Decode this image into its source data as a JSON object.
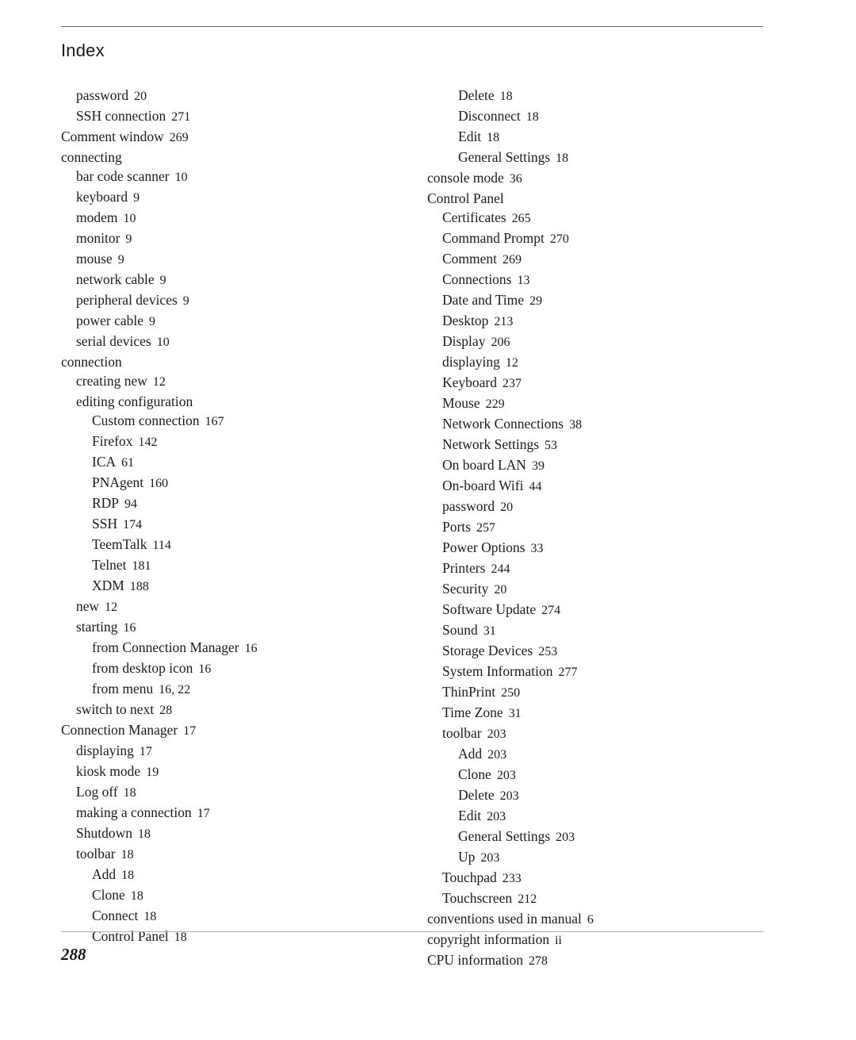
{
  "document": {
    "title": "Index",
    "folio": "288",
    "rule_color_top": "#6b6b6b",
    "rule_color_bottom": "#b3b3b3",
    "text_color": "#1b1b1b",
    "background": "#ffffff"
  },
  "columns": {
    "left": [
      {
        "level": 1,
        "term": "password",
        "pages": "20"
      },
      {
        "level": 1,
        "term": "SSH connection",
        "pages": "271"
      },
      {
        "level": 0,
        "term": "Comment window",
        "pages": "269"
      },
      {
        "level": 0,
        "term": "connecting",
        "pages": ""
      },
      {
        "level": 1,
        "term": "bar code scanner",
        "pages": "10"
      },
      {
        "level": 1,
        "term": "keyboard",
        "pages": "9"
      },
      {
        "level": 1,
        "term": "modem",
        "pages": "10"
      },
      {
        "level": 1,
        "term": "monitor",
        "pages": "9"
      },
      {
        "level": 1,
        "term": "mouse",
        "pages": "9"
      },
      {
        "level": 1,
        "term": "network cable",
        "pages": "9"
      },
      {
        "level": 1,
        "term": "peripheral devices",
        "pages": "9"
      },
      {
        "level": 1,
        "term": "power cable",
        "pages": "9"
      },
      {
        "level": 1,
        "term": "serial devices",
        "pages": "10"
      },
      {
        "level": 0,
        "term": "connection",
        "pages": ""
      },
      {
        "level": 1,
        "term": "creating new",
        "pages": "12"
      },
      {
        "level": 1,
        "term": "editing configuration",
        "pages": ""
      },
      {
        "level": 2,
        "term": "Custom connection",
        "pages": "167"
      },
      {
        "level": 2,
        "term": "Firefox",
        "pages": "142"
      },
      {
        "level": 2,
        "term": "ICA",
        "pages": "61"
      },
      {
        "level": 2,
        "term": "PNAgent",
        "pages": "160"
      },
      {
        "level": 2,
        "term": "RDP",
        "pages": "94"
      },
      {
        "level": 2,
        "term": "SSH",
        "pages": "174"
      },
      {
        "level": 2,
        "term": "TeemTalk",
        "pages": "114"
      },
      {
        "level": 2,
        "term": "Telnet",
        "pages": "181"
      },
      {
        "level": 2,
        "term": "XDM",
        "pages": "188"
      },
      {
        "level": 1,
        "term": "new",
        "pages": "12"
      },
      {
        "level": 1,
        "term": "starting",
        "pages": "16"
      },
      {
        "level": 2,
        "term": "from Connection Manager",
        "pages": "16"
      },
      {
        "level": 2,
        "term": "from desktop icon",
        "pages": "16"
      },
      {
        "level": 2,
        "term": "from menu",
        "pages": "16, 22"
      },
      {
        "level": 1,
        "term": "switch to next",
        "pages": "28"
      },
      {
        "level": 0,
        "term": "Connection Manager",
        "pages": "17"
      },
      {
        "level": 1,
        "term": "displaying",
        "pages": "17"
      },
      {
        "level": 1,
        "term": "kiosk mode",
        "pages": "19"
      },
      {
        "level": 1,
        "term": "Log off",
        "pages": "18"
      },
      {
        "level": 1,
        "term": "making a connection",
        "pages": "17"
      },
      {
        "level": 1,
        "term": "Shutdown",
        "pages": "18"
      },
      {
        "level": 1,
        "term": "toolbar",
        "pages": "18"
      },
      {
        "level": 2,
        "term": "Add",
        "pages": "18"
      },
      {
        "level": 2,
        "term": "Clone",
        "pages": "18"
      },
      {
        "level": 2,
        "term": "Connect",
        "pages": "18"
      },
      {
        "level": 2,
        "term": "Control Panel",
        "pages": "18"
      }
    ],
    "right": [
      {
        "level": 2,
        "term": "Delete",
        "pages": "18"
      },
      {
        "level": 2,
        "term": "Disconnect",
        "pages": "18"
      },
      {
        "level": 2,
        "term": "Edit",
        "pages": "18"
      },
      {
        "level": 2,
        "term": "General Settings",
        "pages": "18"
      },
      {
        "level": 0,
        "term": "console mode",
        "pages": "36"
      },
      {
        "level": 0,
        "term": "Control Panel",
        "pages": ""
      },
      {
        "level": 1,
        "term": "Certificates",
        "pages": "265"
      },
      {
        "level": 1,
        "term": "Command Prompt",
        "pages": "270"
      },
      {
        "level": 1,
        "term": "Comment",
        "pages": "269"
      },
      {
        "level": 1,
        "term": "Connections",
        "pages": "13"
      },
      {
        "level": 1,
        "term": "Date and Time",
        "pages": "29"
      },
      {
        "level": 1,
        "term": "Desktop",
        "pages": "213"
      },
      {
        "level": 1,
        "term": "Display",
        "pages": "206"
      },
      {
        "level": 1,
        "term": "displaying",
        "pages": "12"
      },
      {
        "level": 1,
        "term": "Keyboard",
        "pages": "237"
      },
      {
        "level": 1,
        "term": "Mouse",
        "pages": "229"
      },
      {
        "level": 1,
        "term": "Network Connections",
        "pages": "38"
      },
      {
        "level": 1,
        "term": "Network Settings",
        "pages": "53"
      },
      {
        "level": 1,
        "term": "On board LAN",
        "pages": "39"
      },
      {
        "level": 1,
        "term": "On-board Wifi",
        "pages": "44"
      },
      {
        "level": 1,
        "term": "password",
        "pages": "20"
      },
      {
        "level": 1,
        "term": "Ports",
        "pages": "257"
      },
      {
        "level": 1,
        "term": "Power Options",
        "pages": "33"
      },
      {
        "level": 1,
        "term": "Printers",
        "pages": "244"
      },
      {
        "level": 1,
        "term": "Security",
        "pages": "20"
      },
      {
        "level": 1,
        "term": "Software Update",
        "pages": "274"
      },
      {
        "level": 1,
        "term": "Sound",
        "pages": "31"
      },
      {
        "level": 1,
        "term": "Storage Devices",
        "pages": "253"
      },
      {
        "level": 1,
        "term": "System Information",
        "pages": "277"
      },
      {
        "level": 1,
        "term": "ThinPrint",
        "pages": "250"
      },
      {
        "level": 1,
        "term": "Time Zone",
        "pages": "31"
      },
      {
        "level": 1,
        "term": "toolbar",
        "pages": "203"
      },
      {
        "level": 2,
        "term": "Add",
        "pages": "203"
      },
      {
        "level": 2,
        "term": "Clone",
        "pages": "203"
      },
      {
        "level": 2,
        "term": "Delete",
        "pages": "203"
      },
      {
        "level": 2,
        "term": "Edit",
        "pages": "203"
      },
      {
        "level": 2,
        "term": "General Settings",
        "pages": "203"
      },
      {
        "level": 2,
        "term": "Up",
        "pages": "203"
      },
      {
        "level": 1,
        "term": "Touchpad",
        "pages": "233"
      },
      {
        "level": 1,
        "term": "Touchscreen",
        "pages": "212"
      },
      {
        "level": 0,
        "term": "conventions used in manual",
        "pages": "6"
      },
      {
        "level": 0,
        "term": "copyright information",
        "pages": "ii"
      },
      {
        "level": 0,
        "term": "CPU information",
        "pages": "278"
      }
    ]
  }
}
